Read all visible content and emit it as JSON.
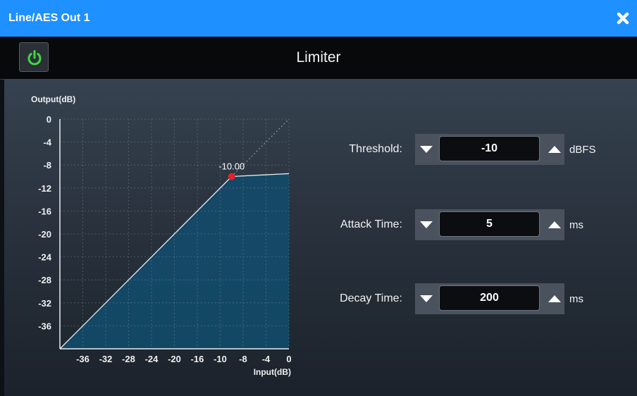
{
  "window": {
    "title": "Line/AES Out 1"
  },
  "icons": {
    "close": "close-icon",
    "power": "power-icon",
    "decrement": "triangle-down-icon",
    "increment": "triangle-up-icon"
  },
  "colors": {
    "titlebar": "#1e90ff",
    "power_on": "#3ddc3d",
    "curve_fill": "#134a68",
    "threshold_dot": "#e8202a"
  },
  "header": {
    "title": "Limiter"
  },
  "chart_data": {
    "type": "line",
    "ylabel": "Output(dB)",
    "xlabel": "Input(dB)",
    "xlim": [
      -40,
      0
    ],
    "ylim": [
      -40,
      0
    ],
    "x_ticks": [
      -36,
      -32,
      -28,
      -24,
      -20,
      -16,
      -12,
      -8,
      -4,
      0
    ],
    "x_tick_labels": [
      "-36",
      "-32",
      "-28",
      "-24",
      "-20",
      "-16",
      "-10",
      "-8",
      "-4",
      "0"
    ],
    "y_ticks": [
      0,
      -4,
      -8,
      -12,
      -16,
      -20,
      -24,
      -28,
      -32,
      -36
    ],
    "y_tick_labels": [
      "0",
      "-4",
      "-8",
      "-12",
      "-16",
      "-20",
      "-24",
      "-28",
      "-32",
      "-36"
    ],
    "grid": true,
    "series": [
      {
        "x": [
          -40,
          -10,
          0
        ],
        "y": [
          -40,
          -10,
          -9.5
        ]
      }
    ],
    "reference_line": {
      "x": [
        -40,
        0
      ],
      "y": [
        -40,
        0
      ]
    },
    "threshold_point": {
      "x": -10,
      "y": -10,
      "label": "-10.00"
    }
  },
  "params": {
    "threshold": {
      "label": "Threshold:",
      "value": "-10",
      "unit": "dBFS"
    },
    "attack": {
      "label": "Attack Time:",
      "value": "5",
      "unit": "ms"
    },
    "decay": {
      "label": "Decay Time:",
      "value": "200",
      "unit": "ms"
    }
  }
}
